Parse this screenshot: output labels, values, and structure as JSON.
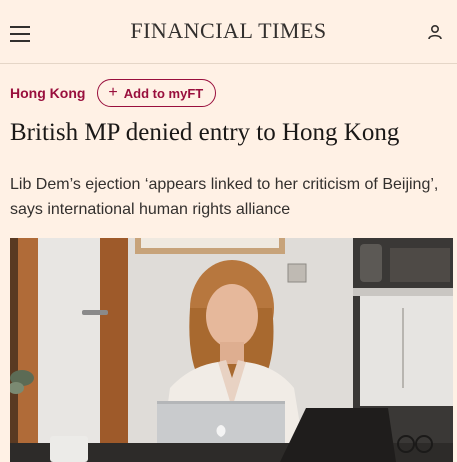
{
  "header": {
    "masthead": "FINANCIAL TIMES",
    "menu_icon": "hamburger-menu-icon",
    "user_icon": "user-account-icon"
  },
  "article": {
    "topic": "Hong Kong",
    "myft_label": "Add to myFT",
    "headline": "British MP denied entry to Hong Kong",
    "standfirst": "Lib Dem’s ejection ‘appears linked to her criticism of Beijing’, says international human rights alliance",
    "image_subject": "woman-at-laptop-photo"
  },
  "colors": {
    "background": "#fff1e5",
    "claret": "#990f3d",
    "text": "#33302e",
    "headline": "#1a1817"
  }
}
